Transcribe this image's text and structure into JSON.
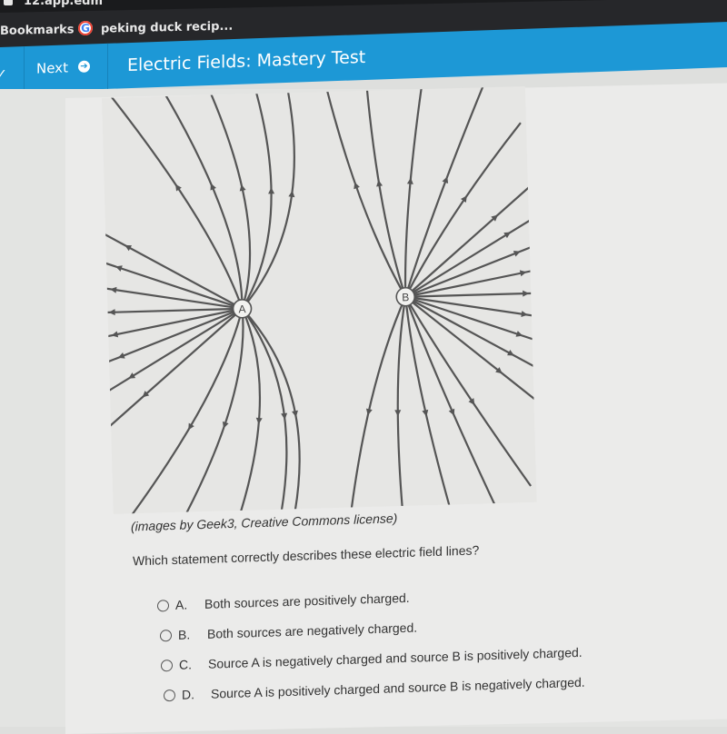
{
  "browser": {
    "url_partial": "12.app.edm",
    "bookmarks": [
      {
        "label": "Bookmarks",
        "icon": "bookmark-icon"
      },
      {
        "label": "peking duck recip...",
        "icon": "google-icon"
      }
    ]
  },
  "nav": {
    "next_label": "Next",
    "next_icon": "arrow-circle-right-icon",
    "check_icon": "checkmark-icon",
    "title": "Electric Fields: Mastery Test"
  },
  "figure": {
    "description": "Electric field lines between two charges",
    "charges": [
      {
        "label": "A",
        "field_direction": "outward"
      },
      {
        "label": "B",
        "field_direction": "outward"
      }
    ]
  },
  "credit": "(images by Geek3, Creative Commons license)",
  "question": "Which statement correctly describes these electric field lines?",
  "options": [
    {
      "letter": "A.",
      "text": "Both sources are positively charged.",
      "selected": false
    },
    {
      "letter": "B.",
      "text": "Both sources are negatively charged.",
      "selected": false
    },
    {
      "letter": "C.",
      "text": "Source A is negatively charged and source B is positively charged.",
      "selected": false
    },
    {
      "letter": "D.",
      "text": "Source A is positively charged and source B is negatively charged.",
      "selected": false
    }
  ],
  "colors": {
    "nav_bar": "#1d98d6",
    "field_line": "#555555",
    "figure_bg": "#e6e6e4"
  }
}
